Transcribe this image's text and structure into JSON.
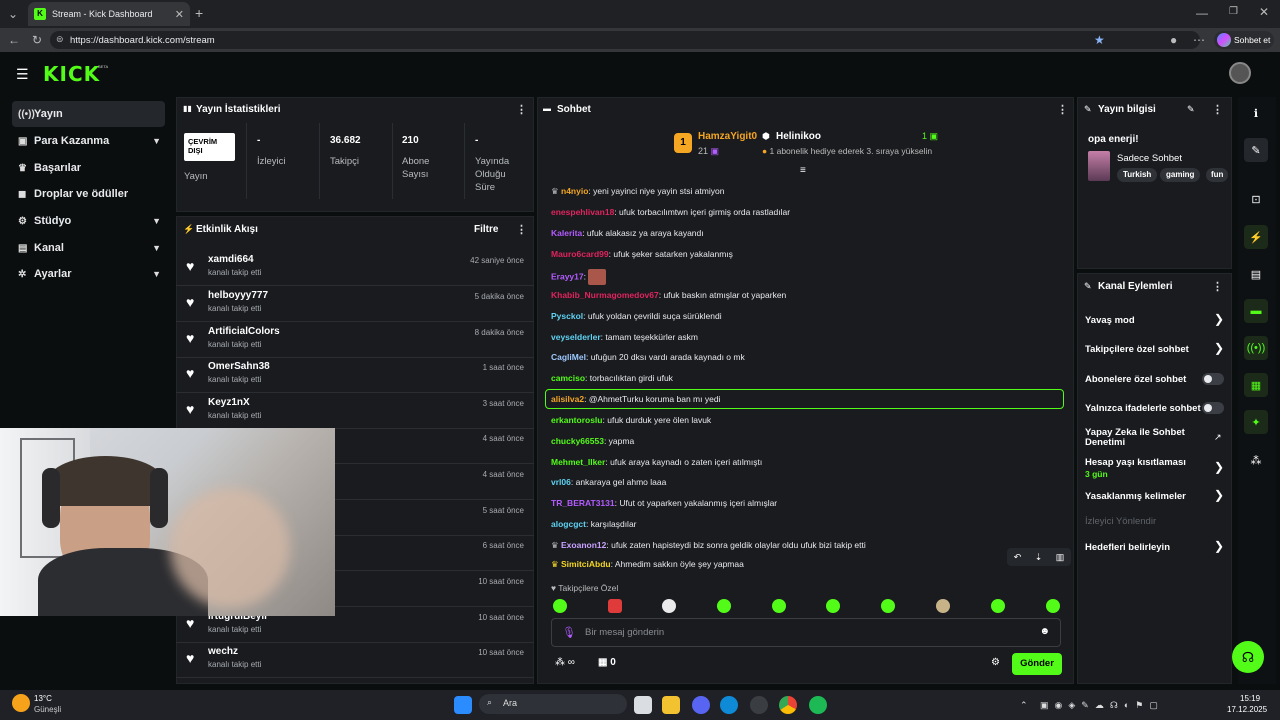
{
  "browser": {
    "tab_title": "Stream - Kick Dashboard",
    "url": "https://dashboard.kick.com/stream",
    "copilot_label": "Sohbet et"
  },
  "header": {
    "logo": "KICK",
    "beta": "BETA"
  },
  "sidebar": {
    "items": [
      {
        "label": "Yayın",
        "icon": "broadcast-icon"
      },
      {
        "label": "Para Kazanma",
        "icon": "money-icon"
      },
      {
        "label": "Başarılar",
        "icon": "trophy-icon"
      },
      {
        "label": "Droplar ve ödüller",
        "icon": "gift-icon"
      },
      {
        "label": "Stüdyo",
        "icon": "studio-icon"
      },
      {
        "label": "Kanal",
        "icon": "channel-icon"
      },
      {
        "label": "Ayarlar",
        "icon": "gear-icon"
      }
    ]
  },
  "stats": {
    "title": "Yayın İstatistikleri",
    "status_badge": "ÇEVRİM DIŞI",
    "status_label": "Yayın",
    "viewers_value": "-",
    "viewers_label": "İzleyici",
    "followers_value": "36.682",
    "followers_label": "Takipçi",
    "subs_value": "210",
    "subs_label": "Abone Sayısı",
    "uptime_value": "-",
    "uptime_label": "Yayında Olduğu Süre"
  },
  "activity": {
    "title": "Etkinlik Akışı",
    "filter": "Filtre",
    "rows": [
      {
        "name": "xamdi664",
        "sub": "kanalı takip etti",
        "time": "42 saniye önce"
      },
      {
        "name": "helboyyy777",
        "sub": "kanalı takip etti",
        "time": "5 dakika önce"
      },
      {
        "name": "ArtificialColors",
        "sub": "kanalı takip etti",
        "time": "8 dakika önce"
      },
      {
        "name": "OmerSahn38",
        "sub": "kanalı takip etti",
        "time": "1 saat önce"
      },
      {
        "name": "Keyz1nX",
        "sub": "kanalı takip etti",
        "time": "3 saat önce"
      },
      {
        "name": "",
        "sub": "",
        "time": "4 saat önce"
      },
      {
        "name": "",
        "sub": "",
        "time": "4 saat önce"
      },
      {
        "name": "",
        "sub": "",
        "time": "5 saat önce"
      },
      {
        "name": "",
        "sub": "",
        "time": "6 saat önce"
      },
      {
        "name": "",
        "sub": "",
        "time": "10 saat önce"
      },
      {
        "name": "IrtugrulBeyli",
        "sub": "kanalı takip etti",
        "time": "10 saat önce"
      },
      {
        "name": "wechz",
        "sub": "kanalı takip etti",
        "time": "10 saat önce"
      }
    ]
  },
  "chat": {
    "title": "Sohbet",
    "pinned_user": "HamzaYigit0",
    "pinned_count": "21",
    "pinned_rank": "1",
    "helper_name": "Helinikoo",
    "helper_count": "1",
    "helper_text": "1 abonelik hediye ederek 3. sıraya yükselin",
    "messages": [
      {
        "user": "n4nyio",
        "text": "yeni yayinci niye yayin stsi atmiyon",
        "color": "#f5a623"
      },
      {
        "user": "enespehlivan18",
        "text": "ufuk torbacılımtwn içeri girmiş orda rastladılar",
        "color": "#e0245e"
      },
      {
        "user": "Kalerita",
        "text": "ufuk alakasız ya araya kayandı",
        "color": "#b45cff"
      },
      {
        "user": "Mauro6card99",
        "text": "ufuk şeker satarken yakalanmış",
        "color": "#e0245e"
      },
      {
        "user": "Erayy17",
        "text": "",
        "color": "#b45cff"
      },
      {
        "user": "Khabib_Nurmagomedov67",
        "text": "ufuk baskın atmışlar ot yaparken",
        "color": "#e0245e"
      },
      {
        "user": "Pysckol",
        "text": "ufuk yoldan çevrildi suça sürüklendi",
        "color": "#5fd3f3"
      },
      {
        "user": "veyselderler",
        "text": "tamam teşekkürler askm",
        "color": "#5fd3f3"
      },
      {
        "user": "CagliMel",
        "text": "ufuğun 20 dksı vardı arada kaynadı o mk",
        "color": "#9ec9ff"
      },
      {
        "user": "camciso",
        "text": "torbacılıktan girdi ufuk",
        "color": "#53fc18"
      },
      {
        "user": "alisilva2",
        "text": "@AhmetTurku koruma ban mı yedi",
        "color": "#f5a623"
      },
      {
        "user": "erkantoroslu",
        "text": "ufuk durduk yere ölen lavuk",
        "color": "#53fc18"
      },
      {
        "user": "chucky66553",
        "text": "yapma",
        "color": "#53fc18"
      },
      {
        "user": "Mehmet_Ilker",
        "text": "ufuk araya kaynadı o zaten içeri atılmıştı",
        "color": "#53fc18"
      },
      {
        "user": "vrl06",
        "text": "ankaraya gel ahmo laaa",
        "color": "#5fd3f3"
      },
      {
        "user": "TR_BERAT3131",
        "text": "Ufut ot yaparken yakalanmış içeri almışlar",
        "color": "#b45cff"
      },
      {
        "user": "alogcgct",
        "text": "karşılaşdılar",
        "color": "#5fd3f3"
      },
      {
        "user": "Exoanon12",
        "text": "ufuk zaten hapisteydi biz sonra geldik olaylar oldu ufuk bizi takip etti",
        "color": "#c9a2ff"
      },
      {
        "user": "SimitciAbdu",
        "text": "Ahmedim sakkın öyle şey yapmaa",
        "color": "#f5d623"
      }
    ],
    "followers_only": "Takipçilere Özel",
    "input_placeholder": "Bir mesaj gönderin",
    "infinity": "∞",
    "gift_count": "0",
    "send_label": "Gönder"
  },
  "stream_info": {
    "title": "Yayın bilgisi",
    "stream_title": "opa enerji!",
    "category": "Sadece Sohbet",
    "tags": [
      "Turkish",
      "gaming",
      "fun"
    ]
  },
  "channel_actions": {
    "title": "Kanal Eylemleri",
    "items": [
      {
        "label": "Yavaş mod",
        "control": "chevron"
      },
      {
        "label": "Takipçilere özel sohbet",
        "control": "chevron"
      },
      {
        "label": "Abonelere özel sohbet",
        "control": "toggle"
      },
      {
        "label": "Yalnızca ifadelerle sohbet",
        "control": "toggle"
      },
      {
        "label": "Yapay Zeka ile Sohbet Denetimi",
        "control": "external"
      },
      {
        "label": "Hesap yaşı kısıtlaması",
        "control": "chevron",
        "sub": "3 gün"
      },
      {
        "label": "Yasaklanmış kelimeler",
        "control": "chevron"
      },
      {
        "label": "İzleyici Yönlendir",
        "control": "disabled"
      },
      {
        "label": "Hedefleri belirleyin",
        "control": "chevron"
      }
    ]
  },
  "taskbar": {
    "weather_temp": "13°C",
    "weather_desc": "Güneşli",
    "search": "Ara",
    "time": "15:19",
    "date": "17.12.2025"
  },
  "colors": {
    "brand": "#53fc18",
    "bg": "#0b0e0f",
    "panel": "#191b1f"
  }
}
